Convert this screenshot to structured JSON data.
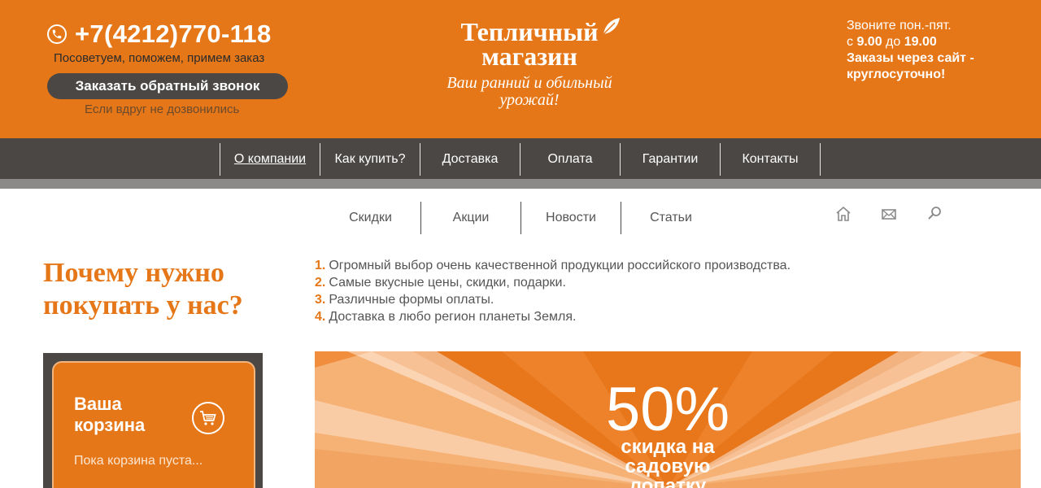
{
  "header": {
    "phone": "+7(4212)770-118",
    "advise": "Посоветуем, поможем, примем заказ",
    "callback_button": "Заказать обратный звонок",
    "cant_reach": "Если вдруг не дозвонились",
    "logo_line1": "Тепличный",
    "logo_line2": "магазин",
    "tagline_line1": "Ваш ранний и обильный",
    "tagline_line2": "урожай!",
    "hours_line1": "Звоните пон.-пят.",
    "hours_from_prefix": "с ",
    "hours_from": "9.00",
    "hours_mid": " до ",
    "hours_to": "19.00",
    "orders_line1": "Заказы через сайт -",
    "orders_line2": "круглосуточно!"
  },
  "main_nav": {
    "items": [
      {
        "label": "О компании"
      },
      {
        "label": "Как купить?"
      },
      {
        "label": "Доставка"
      },
      {
        "label": "Оплата"
      },
      {
        "label": "Гарантии"
      },
      {
        "label": "Контакты"
      }
    ]
  },
  "sub_nav": {
    "items": [
      {
        "label": "Скидки"
      },
      {
        "label": "Акции"
      },
      {
        "label": "Новости"
      },
      {
        "label": "Статьи"
      }
    ],
    "icons": [
      "home-icon",
      "mail-icon",
      "search-icon"
    ]
  },
  "why": {
    "title": "Почему нужно покупать у нас?",
    "items": [
      {
        "num": "1.",
        "text": "Огромный выбор очень качественной продукции российского производства."
      },
      {
        "num": "2.",
        "text": "Самые вкусные цены, скидки, подарки."
      },
      {
        "num": "3.",
        "text": "Различные формы оплаты."
      },
      {
        "num": "4.",
        "text": "Доставка в любо регион планеты Земля."
      }
    ]
  },
  "cart": {
    "title": "Ваша корзина",
    "empty": "Пока корзина пуста...",
    "icon": "cart-icon"
  },
  "banner": {
    "percent": "50%",
    "line1": "скидка на",
    "line2": "садовую",
    "line3": "лопатку"
  },
  "colors": {
    "brand_orange": "#e57718",
    "dark_gray": "#4a4745"
  }
}
